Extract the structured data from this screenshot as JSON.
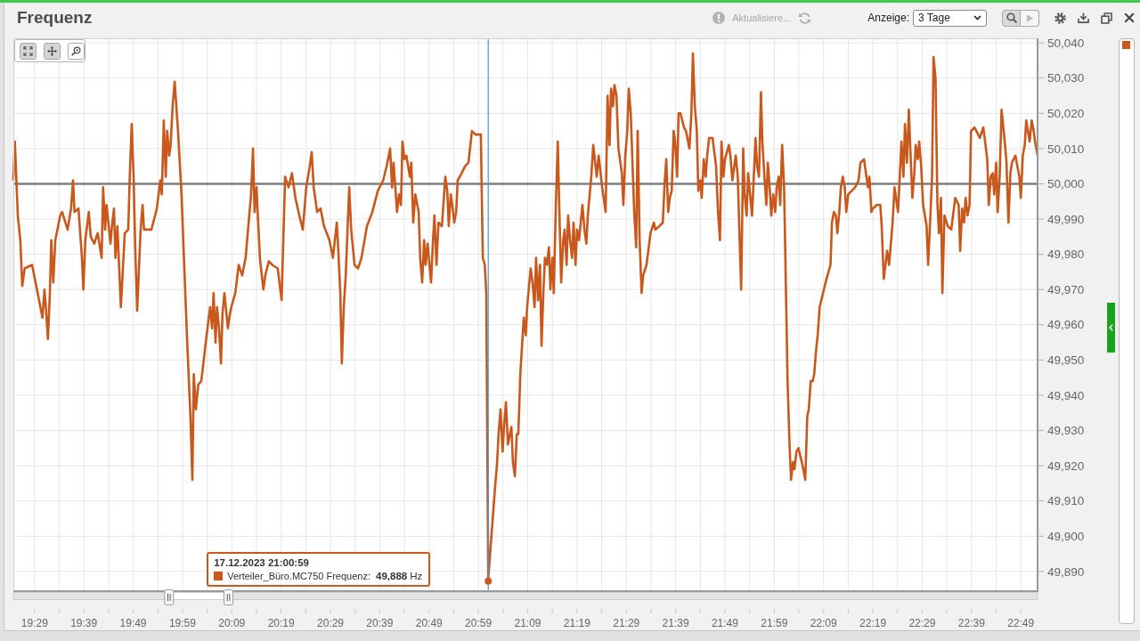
{
  "header": {
    "title": "Frequenz",
    "status": "Aktualisiere...",
    "range": {
      "label": "Anzeige:",
      "value": "3 Tage"
    },
    "mode_buttons": [
      {
        "kind": "zoom",
        "selected": true
      },
      {
        "kind": "play",
        "selected": false
      }
    ]
  },
  "chart": {
    "toolbar": [
      {
        "kind": "reset",
        "selected": true
      },
      {
        "kind": "pan",
        "selected": true
      },
      {
        "kind": "zoom",
        "selected": false
      }
    ],
    "chart_data": {
      "type": "line",
      "grid": true,
      "x": [
        1164.7,
        1165.0,
        1165.6,
        1166.1,
        1166.5,
        1167.0,
        1168.5,
        1169.9,
        1170.6,
        1171.0,
        1171.3,
        1171.7,
        1172.1,
        1172.4,
        1172.8,
        1173.2,
        1174.2,
        1174.6,
        1175.7,
        1176.4,
        1176.8,
        1177.1,
        1177.9,
        1178.6,
        1178.9,
        1179.3,
        1180.0,
        1180.4,
        1181.1,
        1181.8,
        1182.6,
        1182.9,
        1183.3,
        1183.6,
        1184.4,
        1184.7,
        1185.1,
        1185.4,
        1185.8,
        1186.5,
        1187.3,
        1188.0,
        1188.3,
        1188.7,
        1189.1,
        1189.4,
        1189.8,
        1190.5,
        1190.9,
        1191.2,
        1192.7,
        1193.8,
        1194.5,
        1194.8,
        1195.2,
        1195.6,
        1195.9,
        1196.3,
        1196.6,
        1197.0,
        1197.4,
        1198.1,
        1198.8,
        1199.9,
        1200.6,
        1201.0,
        1201.3,
        1201.7,
        1202.2,
        1202.8,
        1203.9,
        1204.6,
        1205.0,
        1205.3,
        1205.7,
        1206.0,
        1206.4,
        1206.8,
        1207.1,
        1207.5,
        1208.2,
        1208.6,
        1208.9,
        1209.7,
        1210.4,
        1211.1,
        1211.8,
        1212.9,
        1213.3,
        1213.6,
        1214.0,
        1214.7,
        1215.4,
        1215.8,
        1216.5,
        1217.2,
        1218.3,
        1219.1,
        1219.8,
        1220.5,
        1221.2,
        1221.9,
        1222.7,
        1223.4,
        1224.1,
        1224.8,
        1225.2,
        1225.6,
        1226.3,
        1227.0,
        1227.7,
        1228.8,
        1229.5,
        1230.3,
        1230.6,
        1231.0,
        1231.3,
        1231.7,
        1232.1,
        1232.8,
        1233.2,
        1233.9,
        1234.6,
        1235.3,
        1236.4,
        1237.5,
        1238.6,
        1239.7,
        1240.4,
        1241.1,
        1241.5,
        1241.8,
        1242.5,
        1242.9,
        1243.3,
        1243.6,
        1244.0,
        1244.4,
        1245.1,
        1245.4,
        1245.8,
        1246.2,
        1246.9,
        1247.2,
        1247.6,
        1248.0,
        1248.3,
        1248.7,
        1249.4,
        1249.8,
        1250.1,
        1250.5,
        1250.9,
        1251.6,
        1252.3,
        1252.7,
        1253.0,
        1253.4,
        1253.8,
        1254.1,
        1254.5,
        1254.8,
        1255.6,
        1256.3,
        1257.0,
        1257.7,
        1258.4,
        1259.5,
        1259.9,
        1260.3,
        1260.6,
        1261.0,
        1262.4,
        1262.8,
        1263.1,
        1263.5,
        1263.9,
        1264.2,
        1264.6,
        1265.0,
        1265.7,
        1266.0,
        1266.4,
        1266.8,
        1267.1,
        1267.5,
        1268.2,
        1268.6,
        1268.9,
        1269.6,
        1270.0,
        1270.4,
        1270.7,
        1271.1,
        1271.5,
        1271.8,
        1272.2,
        1272.5,
        1272.9,
        1273.3,
        1273.6,
        1274.0,
        1274.3,
        1274.7,
        1275.1,
        1275.4,
        1275.8,
        1276.2,
        1276.5,
        1276.9,
        1277.2,
        1277.6,
        1278.0,
        1278.3,
        1278.7,
        1279.0,
        1279.4,
        1280.1,
        1280.5,
        1280.9,
        1281.2,
        1281.9,
        1282.3,
        1282.7,
        1283.0,
        1283.4,
        1284.1,
        1284.8,
        1285.2,
        1285.6,
        1285.9,
        1286.3,
        1286.6,
        1287.0,
        1287.4,
        1288.1,
        1288.4,
        1288.8,
        1289.2,
        1289.5,
        1289.9,
        1290.6,
        1291.0,
        1291.3,
        1291.7,
        1292.1,
        1292.4,
        1293.1,
        1293.9,
        1294.6,
        1294.9,
        1295.7,
        1296.4,
        1296.8,
        1297.1,
        1297.5,
        1297.8,
        1298.2,
        1298.6,
        1298.9,
        1299.3,
        1299.6,
        1300.0,
        1300.7,
        1301.1,
        1301.8,
        1302.2,
        1302.5,
        1302.9,
        1303.3,
        1303.6,
        1304.0,
        1304.3,
        1304.7,
        1305.1,
        1305.4,
        1305.8,
        1306.5,
        1307.2,
        1307.6,
        1308.0,
        1308.3,
        1308.7,
        1309.0,
        1309.8,
        1310.1,
        1310.5,
        1311.2,
        1311.6,
        1311.9,
        1312.3,
        1312.7,
        1313.0,
        1313.4,
        1313.7,
        1314.5,
        1315.2,
        1315.5,
        1315.9,
        1316.3,
        1316.6,
        1317.0,
        1317.4,
        1317.7,
        1318.1,
        1318.4,
        1318.8,
        1319.2,
        1319.5,
        1319.9,
        1320.2,
        1320.6,
        1321.0,
        1321.7,
        1322.1,
        1322.4,
        1322.8,
        1323.1,
        1323.5,
        1323.9,
        1324.6,
        1325.3,
        1325.7,
        1326.0,
        1326.4,
        1326.8,
        1327.1,
        1327.5,
        1327.8,
        1328.2,
        1328.9,
        1329.6,
        1330.4,
        1330.7,
        1331.1,
        1331.5,
        1331.8,
        1332.2,
        1332.5,
        1332.9,
        1333.3,
        1333.6,
        1334.0,
        1334.7,
        1335.4,
        1336.1,
        1336.5,
        1337.2,
        1338.0,
        1338.3,
        1338.7,
        1339.0,
        1339.8,
        1340.5,
        1340.8,
        1341.2,
        1341.9,
        1342.3,
        1342.7,
        1343.0,
        1343.4,
        1344.1,
        1344.8,
        1345.2,
        1345.5,
        1345.9,
        1346.3,
        1346.6,
        1347.0,
        1347.4,
        1347.7,
        1348.1,
        1348.4,
        1348.8,
        1349.2,
        1349.9,
        1350.2,
        1350.6,
        1351.0,
        1351.3,
        1351.7,
        1352.1,
        1352.4,
        1352.8,
        1353.1,
        1353.5,
        1354.2,
        1354.9,
        1355.7,
        1356.4,
        1356.7,
        1357.1,
        1357.5,
        1357.8,
        1358.2,
        1358.6,
        1358.9,
        1359.6,
        1360.0,
        1360.7,
        1361.4,
        1362.2,
        1362.5,
        1362.9,
        1363.3,
        1363.6,
        1364.0,
        1364.3,
        1364.7,
        1365.1,
        1365.4,
        1365.8,
        1366.1,
        1366.5,
        1366.9,
        1367.2,
        1367.9,
        1368.7,
        1369.0,
        1369.4,
        1369.8,
        1370.1,
        1370.8,
        1371.2,
        1371.6,
        1371.9,
        1372.4
      ],
      "series": [
        {
          "color": "#c8581c",
          "values": [
            50001,
            50012,
            49991,
            49984,
            49971,
            49976,
            49977,
            49967,
            49962,
            49970,
            49965,
            49956,
            49969,
            49984,
            49972,
            49984,
            49991,
            49992,
            49987,
            49993,
            50001,
            49992,
            49993,
            49979,
            49970,
            49984,
            49992,
            49985,
            49983,
            49986,
            49979,
            49999,
            49987,
            49994,
            49983,
            49988,
            49993,
            49979,
            49988,
            49965,
            49986,
            49987,
            50002,
            50017,
            50001,
            49982,
            49964,
            49987,
            49994,
            49987,
            49987,
            49993,
            50001,
            49997,
            50018,
            50002,
            50015,
            50008,
            50011,
            50022,
            50029,
            50015,
            49997,
            49957,
            49934,
            49916,
            49946,
            49936,
            49943,
            49944,
            49957,
            49965,
            49959,
            49969,
            49955,
            49965,
            49959,
            49949,
            49963,
            49969,
            49959,
            49963,
            49965,
            49969,
            49977,
            49974,
            49979,
            49997,
            50010,
            49992,
            49999,
            49979,
            49970,
            49974,
            49978,
            49977,
            49976,
            49967,
            50002,
            49999,
            50003,
            49996,
            49991,
            49987,
            49999,
            50005,
            50009,
            49999,
            49992,
            49993,
            49988,
            49984,
            49979,
            49989,
            49981,
            49969,
            49949,
            49965,
            49974,
            49999,
            49987,
            49977,
            49976,
            49979,
            49988,
            49992,
            49998,
            50001,
            50005,
            50010,
            49999,
            50006,
            49992,
            49997,
            49994,
            50012,
            50007,
            50008,
            50002,
            50006,
            49989,
            49997,
            49992,
            49979,
            49972,
            49984,
            49977,
            49983,
            49972,
            49984,
            49991,
            49977,
            49989,
            49988,
            50002,
            49998,
            49988,
            49997,
            49993,
            49989,
            49992,
            50001,
            50003,
            50005,
            50006,
            50015,
            50014,
            50014,
            49979,
            49977,
            49969,
            49888,
            49914,
            49921,
            49929,
            49936,
            49924,
            49931,
            49938,
            49926,
            49931,
            49921,
            49917,
            49929,
            49929,
            49946,
            49962,
            49957,
            49965,
            49976,
            49972,
            49965,
            49979,
            49967,
            49977,
            49954,
            49970,
            49979,
            49977,
            49982,
            49970,
            49979,
            49969,
            49994,
            50012,
            49994,
            49972,
            49984,
            49987,
            49977,
            49991,
            49984,
            49979,
            49989,
            49977,
            49987,
            49984,
            49994,
            49987,
            49983,
            49991,
            50002,
            50011,
            50006,
            50002,
            50008,
            49999,
            49992,
            50025,
            50011,
            50027,
            50022,
            50028,
            50025,
            50010,
            50003,
            49994,
            50008,
            50015,
            50027,
            50020,
            49992,
            49982,
            50015,
            49984,
            49969,
            49974,
            49977,
            49986,
            49989,
            49987,
            49988,
            49989,
            50001,
            50007,
            49992,
            49996,
            49998,
            50015,
            50012,
            50002,
            50020,
            50020,
            50016,
            50015,
            50010,
            50020,
            50037,
            50022,
            50015,
            49998,
            50001,
            49996,
            50007,
            50002,
            50008,
            50013,
            50013,
            50005,
            49992,
            49984,
            50012,
            50002,
            50007,
            50011,
            50008,
            50001,
            50008,
            50002,
            49988,
            49970,
            50010,
            49997,
            49991,
            50003,
            49991,
            50013,
            50005,
            50002,
            50026,
            50012,
            50002,
            49994,
            50006,
            49998,
            49991,
            49997,
            49992,
            49999,
            50002,
            49994,
            50011,
            49999,
            49944,
            49926,
            49916,
            49921,
            49919,
            49924,
            49925,
            49921,
            49916,
            49934,
            49936,
            49944,
            49944,
            49946,
            49953,
            49957,
            49965,
            49969,
            49973,
            49977,
            49989,
            49992,
            49991,
            49986,
            49992,
            49999,
            50002,
            49999,
            49992,
            49997,
            49998,
            49999,
            50001,
            50006,
            50007,
            49999,
            50002,
            49992,
            49993,
            49994,
            49994,
            49988,
            49973,
            49981,
            49977,
            49984,
            49989,
            49999,
            49992,
            50012,
            50002,
            50017,
            50006,
            50021,
            50010,
            49996,
            50003,
            50011,
            50007,
            50012,
            50005,
            49994,
            49988,
            49977,
            49989,
            50002,
            50036,
            50030,
            49994,
            49986,
            49996,
            49969,
            49991,
            49988,
            49987,
            49996,
            49994,
            49981,
            49993,
            49989,
            49996,
            49991,
            49994,
            50015,
            50016,
            50015,
            50013,
            50016,
            50007,
            49994,
            50002,
            50003,
            49997,
            50006,
            49992,
            50002,
            50021,
            50017,
            50011,
            50006,
            49989,
            50003,
            50006,
            50008,
            50002,
            49996,
            50008,
            50011,
            50018,
            50012,
            50018,
            50015,
            50012,
            50008
          ]
        }
      ],
      "xlim": [
        1164.7,
        1372.4
      ],
      "ylim": [
        49884.4,
        50041.3
      ],
      "xticks": [
        {
          "value": 1169,
          "label": "19:29"
        },
        {
          "value": 1179,
          "label": "19:39"
        },
        {
          "value": 1189,
          "label": "19:49"
        },
        {
          "value": 1199,
          "label": "19:59"
        },
        {
          "value": 1209,
          "label": "20:09"
        },
        {
          "value": 1219,
          "label": "20:19"
        },
        {
          "value": 1229,
          "label": "20:29"
        },
        {
          "value": 1239,
          "label": "20:39"
        },
        {
          "value": 1249,
          "label": "20:49"
        },
        {
          "value": 1259,
          "label": "20:59"
        },
        {
          "value": 1269,
          "label": "21:09"
        },
        {
          "value": 1279,
          "label": "21:19"
        },
        {
          "value": 1289,
          "label": "21:29"
        },
        {
          "value": 1299,
          "label": "21:39"
        },
        {
          "value": 1309,
          "label": "21:49"
        },
        {
          "value": 1319,
          "label": "21:59"
        },
        {
          "value": 1329,
          "label": "22:09"
        },
        {
          "value": 1339,
          "label": "22:19"
        },
        {
          "value": 1349,
          "label": "22:29"
        },
        {
          "value": 1359,
          "label": "22:39"
        },
        {
          "value": 1369,
          "label": "22:49"
        }
      ],
      "yticks": [
        {
          "value": 49890,
          "label": "49,890"
        },
        {
          "value": 49900,
          "label": "49,900"
        },
        {
          "value": 49910,
          "label": "49,910"
        },
        {
          "value": 49920,
          "label": "49,920"
        },
        {
          "value": 49930,
          "label": "49,930"
        },
        {
          "value": 49940,
          "label": "49,940"
        },
        {
          "value": 49950,
          "label": "49,950"
        },
        {
          "value": 49960,
          "label": "49,960"
        },
        {
          "value": 49970,
          "label": "49,970"
        },
        {
          "value": 49980,
          "label": "49,980"
        },
        {
          "value": 49990,
          "label": "49,990"
        },
        {
          "value": 50000,
          "label": "50,000"
        },
        {
          "value": 50010,
          "label": "50,010"
        },
        {
          "value": 50020,
          "label": "50,020"
        },
        {
          "value": 50030,
          "label": "50,030"
        },
        {
          "value": 50040,
          "label": "50,040"
        }
      ],
      "ref_lines": [
        {
          "axis": "y",
          "value": 50000
        },
        {
          "axis": "x",
          "value": 1261.0
        }
      ]
    },
    "tooltip": {
      "time": "17.12.2023 21:00:59",
      "label": "Verteiler_Büro.MC750 Frequenz:",
      "value": "49,888",
      "unit": "Hz"
    },
    "navigator": {
      "handles": [
        {
          "level": 0.152
        },
        {
          "level": 0.21
        }
      ]
    }
  }
}
